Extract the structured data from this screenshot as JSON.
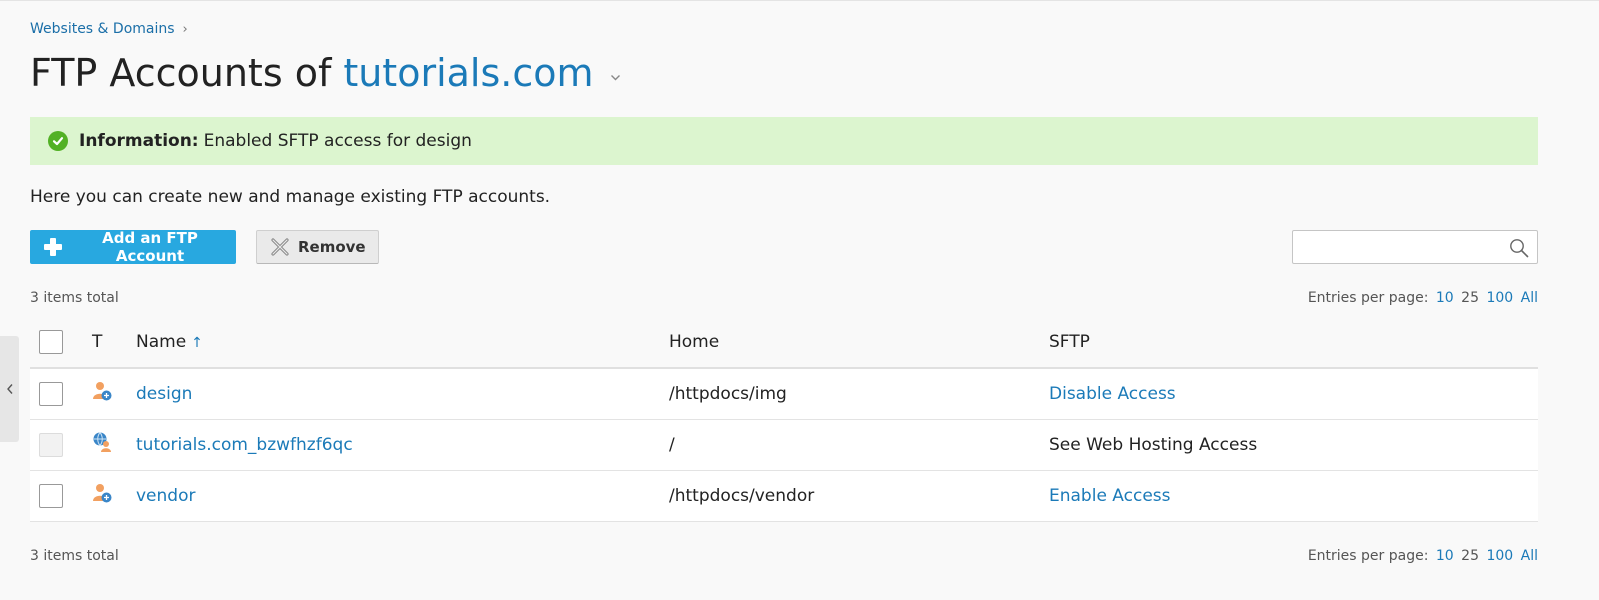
{
  "breadcrumb": {
    "label": "Websites & Domains",
    "separator": "›"
  },
  "header": {
    "title_prefix": "FTP Accounts of",
    "domain": "tutorials.com"
  },
  "message": {
    "label": "Information:",
    "text": "Enabled SFTP access for design",
    "color": "#dcf5cf"
  },
  "description": "Here you can create new and manage existing FTP accounts.",
  "toolbar": {
    "add_label": "Add an FTP Account",
    "remove_label": "Remove",
    "search_placeholder": ""
  },
  "summary": {
    "total": "3 items total",
    "per_page_label": "Entries per page:",
    "options": [
      "10",
      "25",
      "100",
      "All"
    ]
  },
  "table": {
    "columns": {
      "type": "T",
      "name": "Name",
      "sort_indicator": "↑",
      "home": "Home",
      "sftp": "SFTP"
    },
    "rows": [
      {
        "name": "design",
        "icon": "ftp-user-icon",
        "home": "/httpdocs/img",
        "sftp": "Disable Access",
        "sftp_is_link": true,
        "checkbox_enabled": true
      },
      {
        "name": "tutorials.com_bzwfhzf6qc",
        "icon": "web-user-icon",
        "home": "/",
        "sftp": "See Web Hosting Access",
        "sftp_is_link": false,
        "checkbox_enabled": false
      },
      {
        "name": "vendor",
        "icon": "ftp-user-icon",
        "home": "/httpdocs/vendor",
        "sftp": "Enable Access",
        "sftp_is_link": true,
        "checkbox_enabled": true
      }
    ]
  },
  "colors": {
    "accent": "#1b7ab8",
    "primary_button": "#28a8e0",
    "success": "#52b125"
  }
}
